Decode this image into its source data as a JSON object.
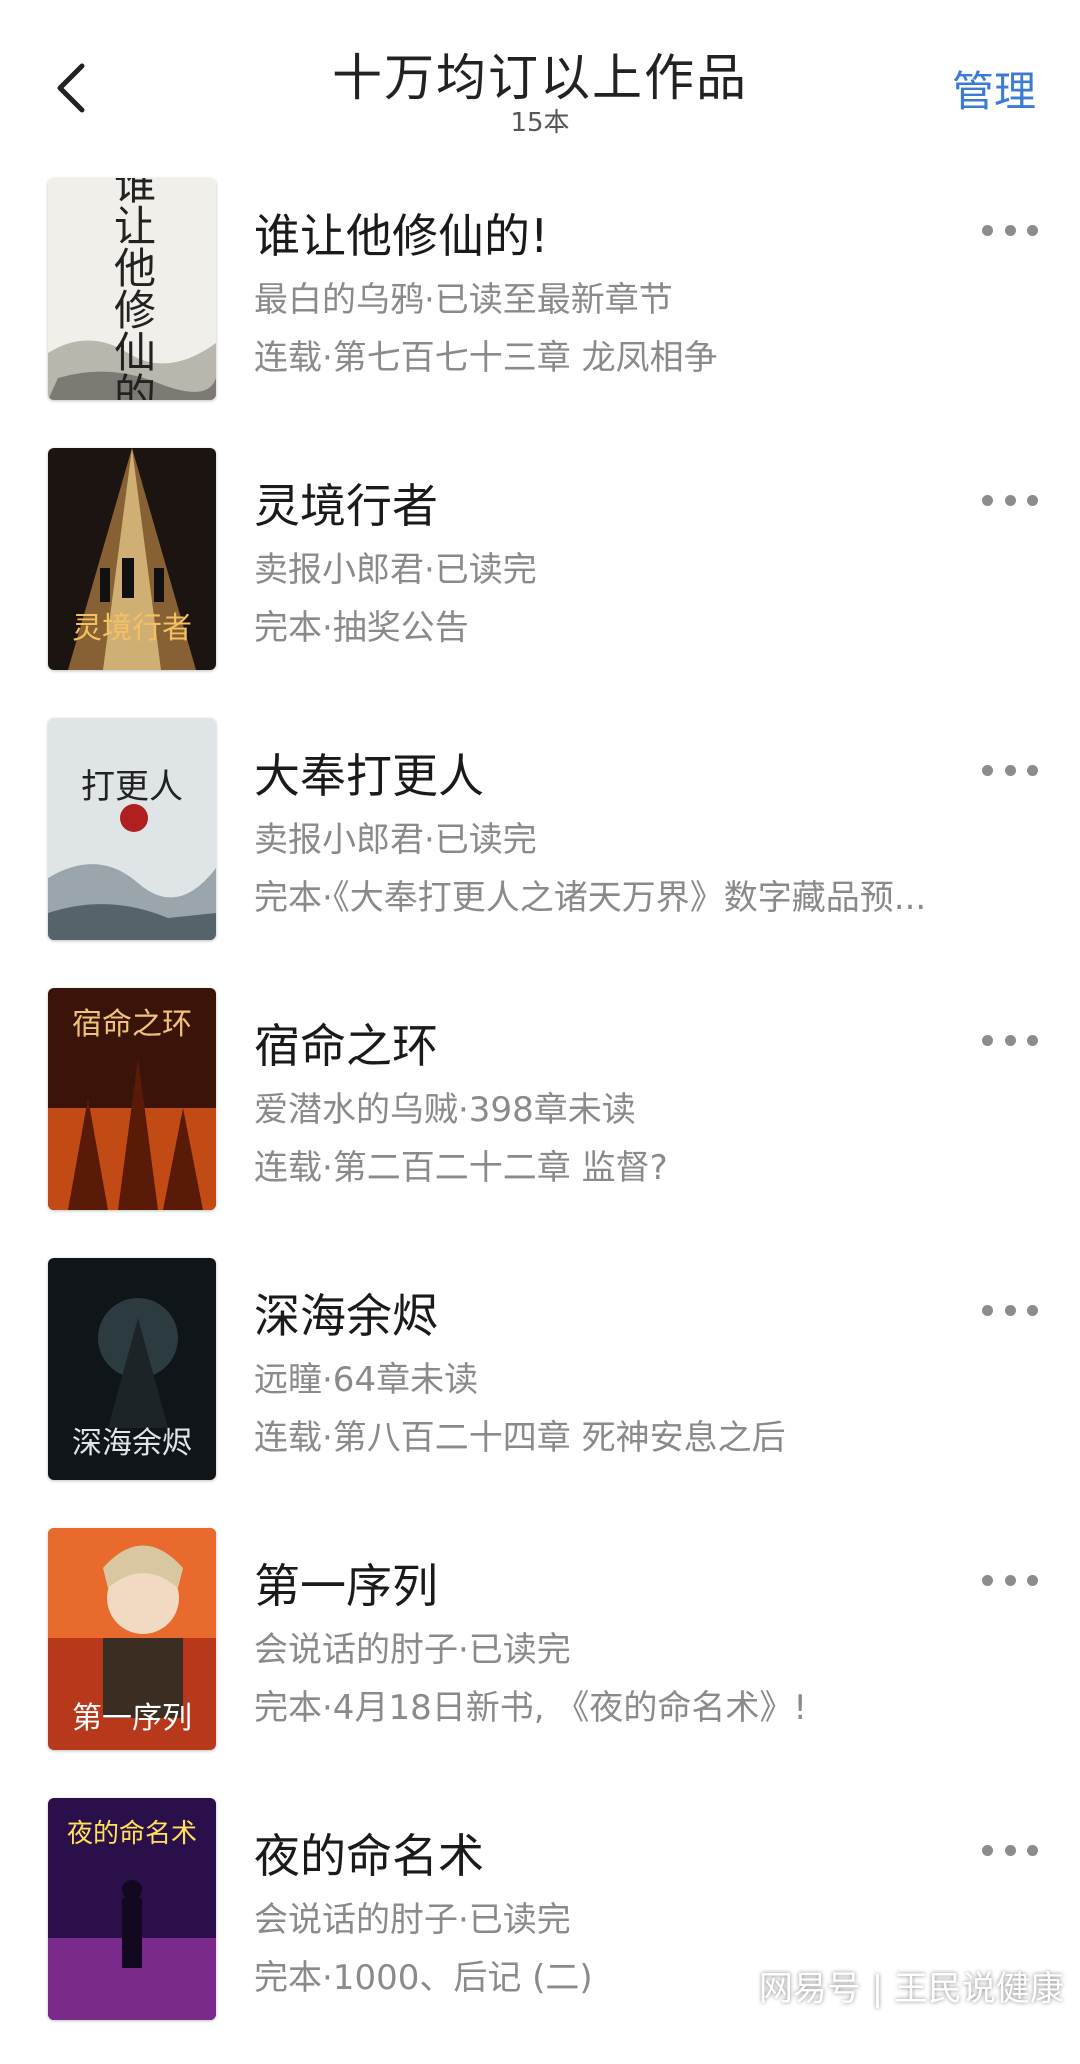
{
  "header": {
    "title": "十万均订以上作品",
    "count": "15本",
    "manage_label": "管理"
  },
  "books": [
    {
      "title": "谁让他修仙的!",
      "line2": "最白的乌鸦·已读至最新章节",
      "line3": "连载·第七百七十三章 龙凤相争",
      "cover_text": "谁让他修仙的"
    },
    {
      "title": "灵境行者",
      "line2": "卖报小郎君·已读完",
      "line3": "完本·抽奖公告",
      "cover_text": "灵境行者"
    },
    {
      "title": "大奉打更人",
      "line2": "卖报小郎君·已读完",
      "line3": "完本·《大奉打更人之诸天万界》数字藏品预...",
      "cover_text": "打更人"
    },
    {
      "title": "宿命之环",
      "line2": "爱潜水的乌贼·398章未读",
      "line3": "连载·第二百二十二章 监督?",
      "cover_text": "宿命之环"
    },
    {
      "title": "深海余烬",
      "line2": "远瞳·64章未读",
      "line3": "连载·第八百二十四章 死神安息之后",
      "cover_text": "深海余烬"
    },
    {
      "title": "第一序列",
      "line2": "会说话的肘子·已读完",
      "line3": "完本·4月18日新书, 《夜的命名术》!",
      "cover_text": "第一序列"
    },
    {
      "title": "夜的命名术",
      "line2": "会说话的肘子·已读完",
      "line3": "完本·1000、后记 (二)",
      "cover_text": "夜的命名术"
    }
  ],
  "watermark": "网易号 | 王民说健康",
  "colors": {
    "accent": "#3a7bd5",
    "secondary_text": "#8a8a8a"
  }
}
